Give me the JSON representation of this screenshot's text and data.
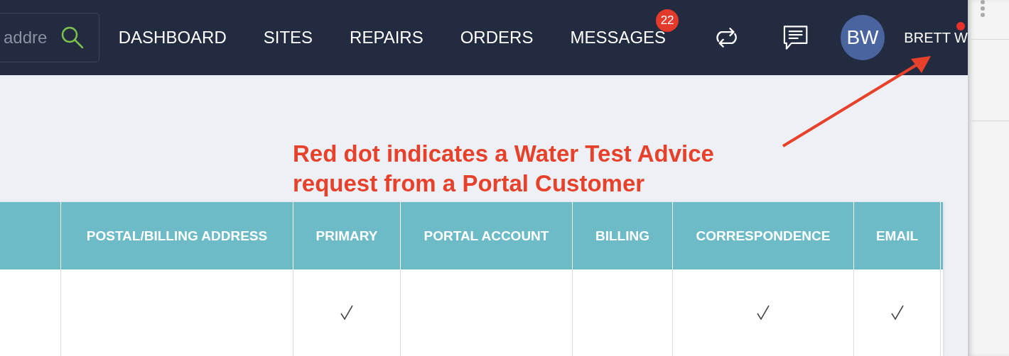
{
  "search": {
    "placeholder": "addre"
  },
  "nav": [
    {
      "label": "DASHBOARD"
    },
    {
      "label": "SITES"
    },
    {
      "label": "REPAIRS"
    },
    {
      "label": "ORDERS"
    },
    {
      "label": "MESSAGES",
      "badge": "22"
    }
  ],
  "user": {
    "initials": "BW",
    "name": "BRETT W",
    "notification_dot": true
  },
  "annotation": {
    "lines": [
      "Red dot indicates a Water Test Advice",
      "request from a Portal Customer"
    ]
  },
  "table": {
    "columns": [
      {},
      {
        "label": "POSTAL/BILLING ADDRESS"
      },
      {
        "label": "PRIMARY"
      },
      {
        "label": "PORTAL ACCOUNT"
      },
      {
        "label": "BILLING"
      },
      {
        "label": "CORRESPONDENCE"
      },
      {
        "label": "EMAIL"
      }
    ],
    "rows": [
      {
        "checks": [
          false,
          false,
          true,
          false,
          false,
          true,
          true
        ]
      }
    ]
  }
}
